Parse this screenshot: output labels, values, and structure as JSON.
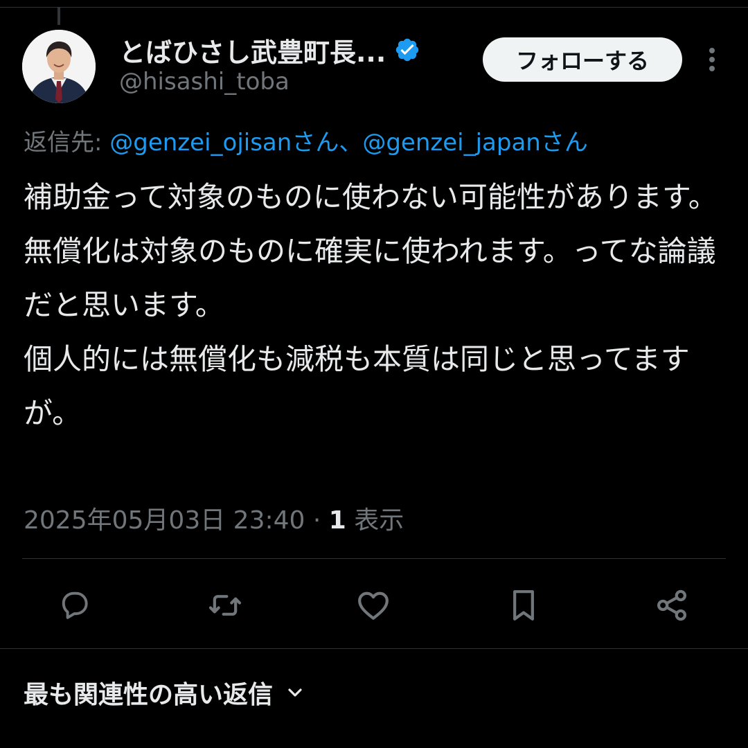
{
  "author": {
    "display_name": "とばひさし武豊町長...",
    "handle": "@hisashi_toba",
    "verified": true,
    "avatar_icon": "profile-photo"
  },
  "follow_button": {
    "label": "フォローする"
  },
  "more_icon": "three-dots-vertical-icon",
  "reply_to": {
    "prefix": "返信先: ",
    "mention_1": "@genzei_ojisan",
    "suffix_1": "さん、",
    "mention_2": "@genzei_japan",
    "suffix_2": "さん"
  },
  "tweet": {
    "text": "補助金って対象のものに使わない可能性があります。\n無償化は対象のものに確実に使われます。ってな論議だと思います。\n個人的には無償化も減税も本質は同じと思ってますが。"
  },
  "meta": {
    "timestamp": "2025年05月03日 23:40",
    "separator": " · ",
    "views_count": "1",
    "views_label": " 表示"
  },
  "actions": [
    {
      "name": "reply",
      "icon": "speech-bubble-icon"
    },
    {
      "name": "repost",
      "icon": "repost-arrows-icon"
    },
    {
      "name": "like",
      "icon": "heart-icon"
    },
    {
      "name": "bookmark",
      "icon": "bookmark-icon"
    },
    {
      "name": "share",
      "icon": "share-nodes-icon"
    }
  ],
  "replies_sort": {
    "label": "最も関連性の高い返信"
  },
  "colors": {
    "background": "#000000",
    "text_primary": "#e7e9ea",
    "text_secondary": "#71767b",
    "link": "#1d9bf0",
    "verified": "#1d9bf0",
    "divider": "#2f3336",
    "follow_bg": "#eff3f4"
  }
}
